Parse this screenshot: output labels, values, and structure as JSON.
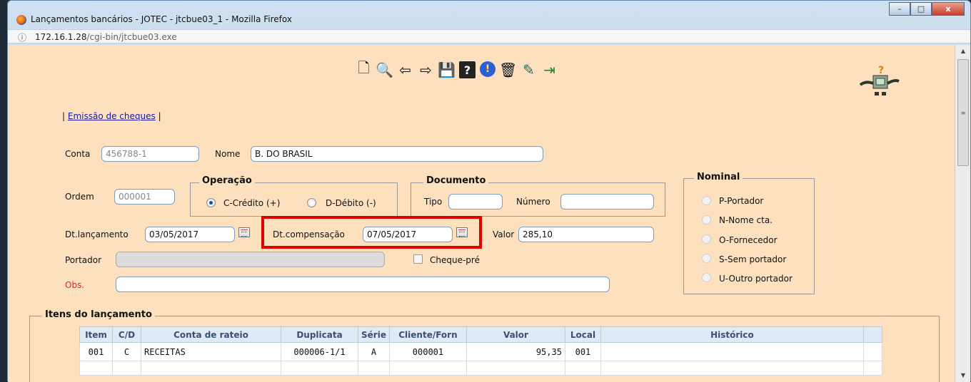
{
  "window": {
    "title": "Lançamentos bancários - JOTEC - jtcbue03_1 - Mozilla Firefox",
    "buttons": {
      "minimize": "–",
      "maximize": "□",
      "close": "x"
    }
  },
  "address": {
    "host": "172.16.1.28",
    "path": "/cgi-bin/jtcbue03.exe"
  },
  "toolbar": {
    "icons": [
      "new-document-icon",
      "binoculars-search-icon",
      "arrow-left-icon",
      "arrow-right-icon",
      "save-disk-icon",
      "help-question-icon",
      "info-exclamation-icon",
      "trash-icon",
      "edit-note-icon",
      "exit-door-icon"
    ],
    "glyphs": [
      "🗋",
      "🔍",
      "⇦",
      "⇨",
      "💾",
      "?",
      "!",
      "🗑",
      "✎",
      "⇥"
    ]
  },
  "nav": {
    "pipe_left": "|",
    "link": "Emissão de cheques",
    "pipe_right": "|"
  },
  "form": {
    "conta_label": "Conta",
    "conta_value": "456788-1",
    "nome_label": "Nome",
    "nome_value": "B. DO BRASIL",
    "ordem_label": "Ordem",
    "ordem_value": "000001",
    "operacao": {
      "legend": "Operação",
      "credito": "C-Crédito (+)",
      "debito": "D-Débito (-)",
      "selected": "credito"
    },
    "documento": {
      "legend": "Documento",
      "tipo_label": "Tipo",
      "tipo_value": "",
      "numero_label": "Número",
      "numero_value": ""
    },
    "dt_lancamento_label": "Dt.lançamento",
    "dt_lancamento_value": "03/05/2017",
    "dt_compensacao_label": "Dt.compensação",
    "dt_compensacao_value": "07/05/2017",
    "valor_label": "Valor",
    "valor_value": "285,10",
    "portador_label": "Portador",
    "portador_value": "",
    "cheque_pre_label": "Cheque-pré",
    "obs_label": "Obs.",
    "obs_value": ""
  },
  "nominal": {
    "legend": "Nominal",
    "options": [
      "P-Portador",
      "N-Nome cta.",
      "O-Fornecedor",
      "S-Sem portador",
      "U-Outro portador"
    ]
  },
  "itens": {
    "legend": "Itens do lançamento",
    "headers": [
      "Item",
      "C/D",
      "Conta de rateio",
      "Duplicata",
      "Série",
      "Cliente/Forn",
      "Valor",
      "Local",
      "Histórico"
    ],
    "rows": [
      [
        "001",
        "C",
        "RECEITAS",
        "000006-1/1",
        "A",
        "000001",
        "95,35",
        "001",
        ""
      ]
    ]
  },
  "colors": {
    "page_bg": "#fde0be",
    "highlight": "#e00000",
    "link": "#1a1aa6"
  }
}
